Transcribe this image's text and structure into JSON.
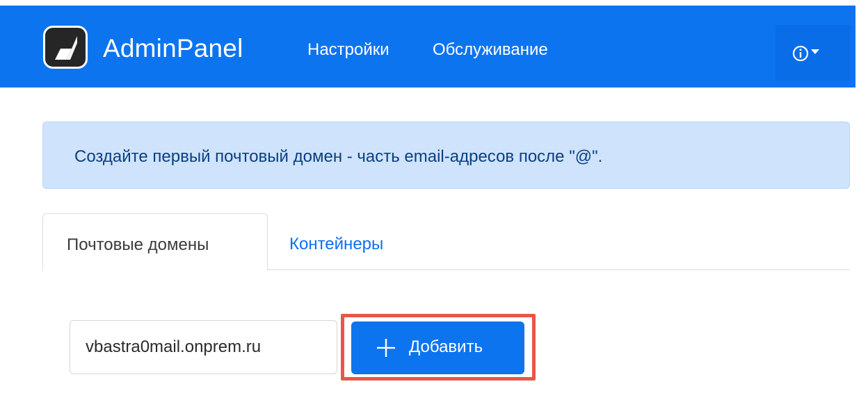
{
  "navbar": {
    "brand": "AdminPanel",
    "links": [
      "Настройки",
      "Обслуживание"
    ],
    "accent_color": "#0d74f0",
    "info_icon": "info-circle-icon",
    "caret_icon": "caret-down-icon"
  },
  "alert": {
    "text": "Создайте первый почтовый домен - часть email-адресов после \"@\"."
  },
  "tabs": [
    {
      "label": "Почтовые домены",
      "active": true
    },
    {
      "label": "Контейнеры",
      "active": false
    }
  ],
  "domain_form": {
    "input_value": "vbastra0mail.onprem.ru",
    "add_label": "Добавить",
    "add_icon": "plus-icon",
    "highlight_color": "#ea5549"
  }
}
